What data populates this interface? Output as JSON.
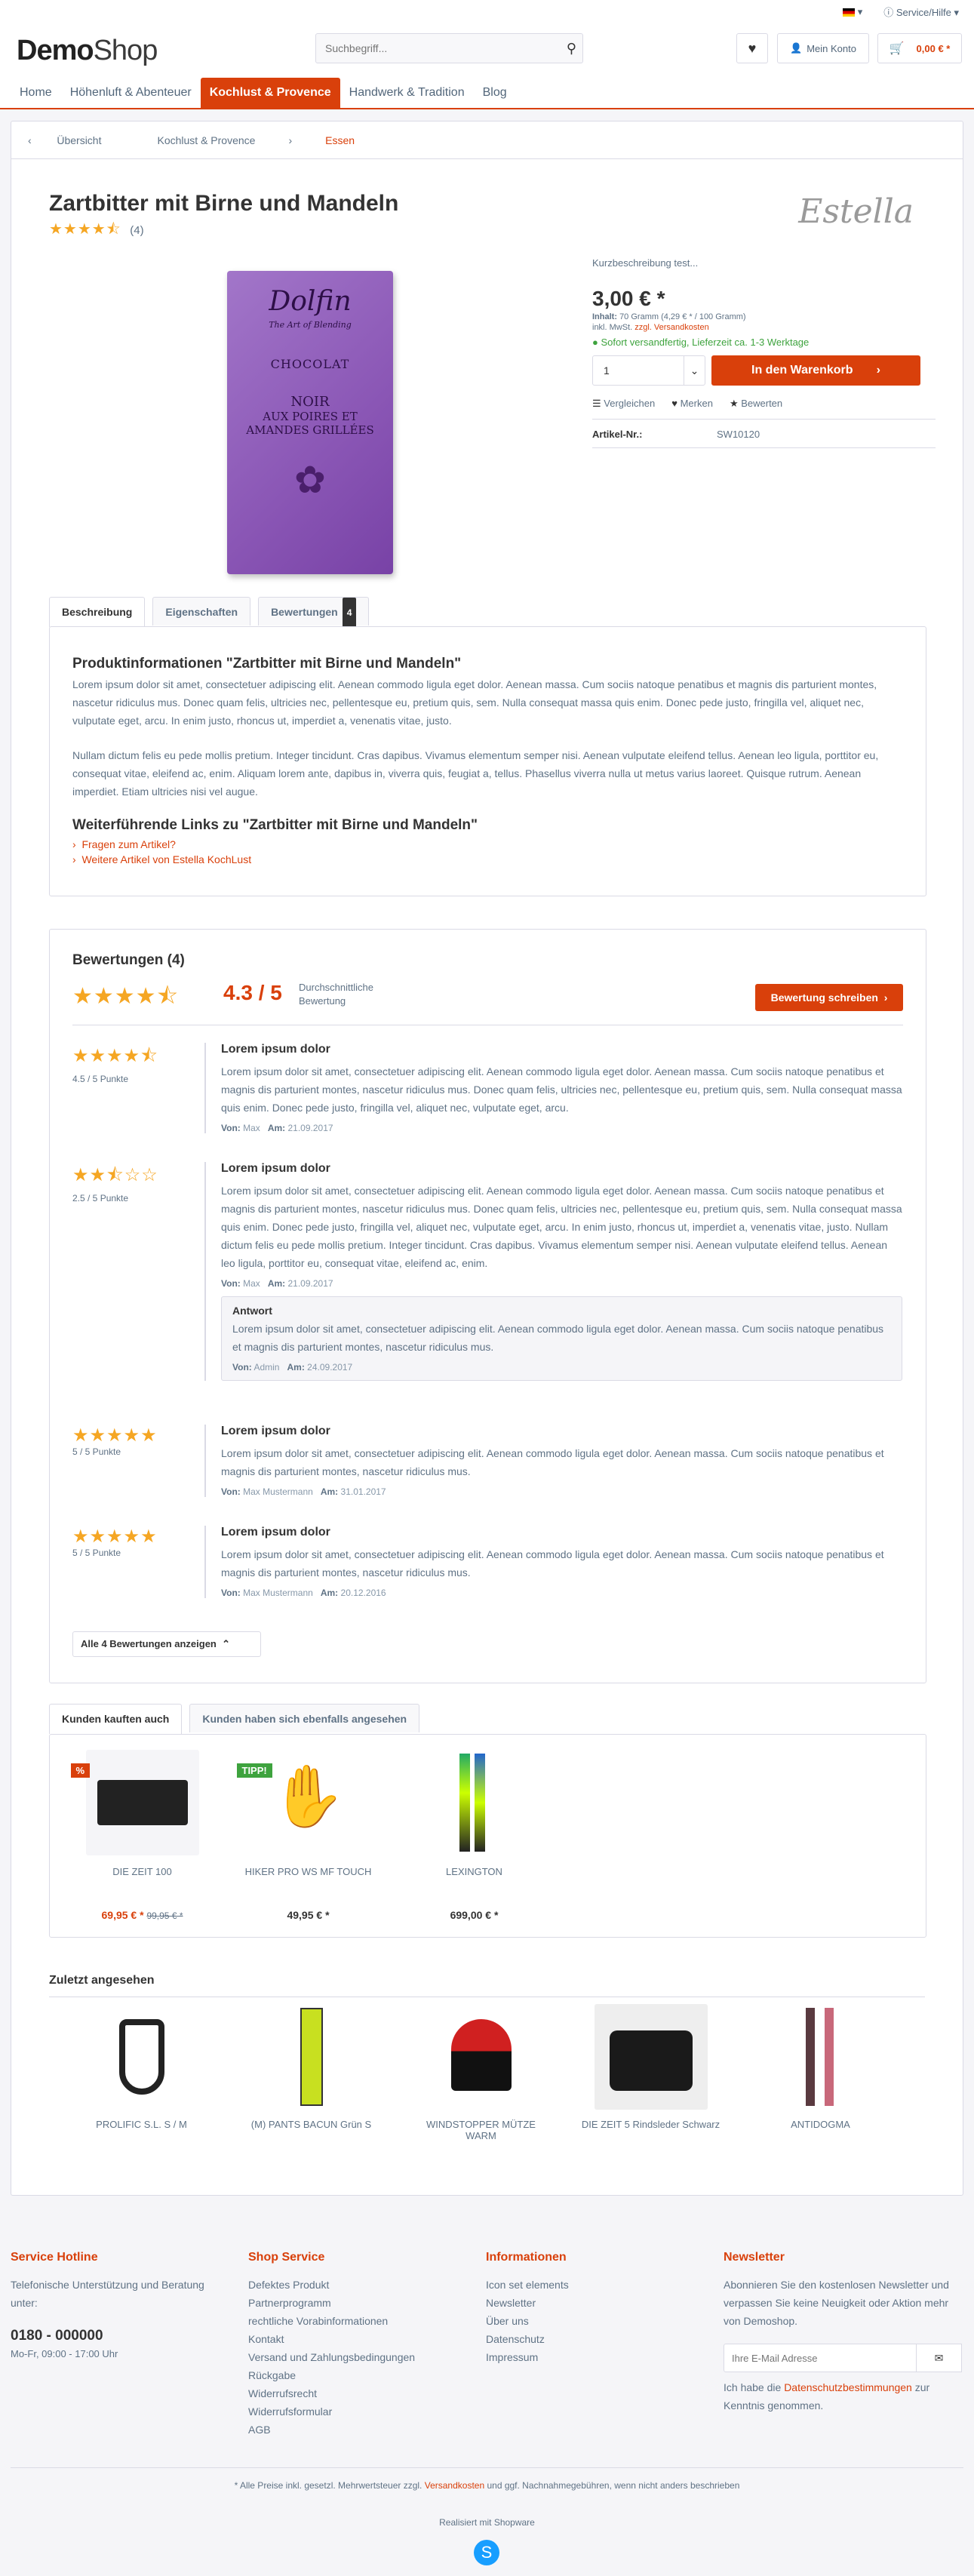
{
  "topbar": {
    "service": "Service/Hilfe"
  },
  "header": {
    "logo_a": "Demo",
    "logo_b": "Shop",
    "search_placeholder": "Suchbegriff...",
    "account": "Mein Konto",
    "cart_total": "0,00 € *"
  },
  "nav": {
    "items": [
      "Home",
      "Höhenluft & Abenteuer",
      "Kochlust & Provence",
      "Handwerk & Tradition",
      "Blog"
    ]
  },
  "breadcrumb": {
    "back": "Übersicht",
    "category": "Kochlust & Provence",
    "current": "Essen"
  },
  "product": {
    "title": "Zartbitter mit Birne und Mandeln",
    "rating_count": "(4)",
    "supplier": "Estella",
    "image_text": {
      "brand": "Dolfin",
      "sub": "The Art of Blending",
      "choc": "CHOCOLAT",
      "noir": "NOIR",
      "line1": "AUX POIRES ET",
      "line2": "AMANDES GRILLÉES"
    },
    "short_desc": "Kurzbeschreibung test...",
    "price": "3,00 € *",
    "content_label": "Inhalt:",
    "content": "70 Gramm (4,29 € * / 100 Gramm)",
    "tax": "inkl. MwSt.",
    "shipping_link": "zzgl. Versandkosten",
    "delivery": "Sofort versandfertig, Lieferzeit ca. 1-3 Werktage",
    "qty": "1",
    "cart_button": "In den Warenkorb",
    "compare": "Vergleichen",
    "remember": "Merken",
    "rate": "Bewerten",
    "sku_label": "Artikel-Nr.:",
    "sku": "SW10120"
  },
  "tabs": {
    "desc": "Beschreibung",
    "props": "Eigenschaften",
    "ratings": "Bewertungen",
    "ratings_count": "4"
  },
  "description": {
    "heading": "Produktinformationen \"Zartbitter mit Birne und Mandeln\"",
    "p1": "Lorem ipsum dolor sit amet, consectetuer adipiscing elit. Aenean commodo ligula eget dolor. Aenean massa. Cum sociis natoque penatibus et magnis dis parturient montes, nascetur ridiculus mus. Donec quam felis, ultricies nec, pellentesque eu, pretium quis, sem. Nulla consequat massa quis enim. Donec pede justo, fringilla vel, aliquet nec, vulputate eget, arcu. In enim justo, rhoncus ut, imperdiet a, venenatis vitae, justo.",
    "p2": "Nullam dictum felis eu pede mollis pretium. Integer tincidunt. Cras dapibus. Vivamus elementum semper nisi. Aenean vulputate eleifend tellus. Aenean leo ligula, porttitor eu, consequat vitae, eleifend ac, enim. Aliquam lorem ante, dapibus in, viverra quis, feugiat a, tellus. Phasellus viverra nulla ut metus varius laoreet. Quisque rutrum. Aenean imperdiet. Etiam ultricies nisi vel augue.",
    "links_heading": "Weiterführende Links zu \"Zartbitter mit Birne und Mandeln\"",
    "link1": "Fragen zum Artikel?",
    "link2": "Weitere Artikel von Estella KochLust"
  },
  "ratings": {
    "heading": "Bewertungen (4)",
    "avg": "4.3 / 5",
    "avg_label": "Durchschnittliche Bewertung",
    "write_button": "Bewertung schreiben",
    "show_all": "Alle 4 Bewertungen anzeigen",
    "reviews": [
      {
        "stars": "★★★★⯪",
        "points": "4.5 / 5 Punkte",
        "title": "Lorem ipsum dolor",
        "text": "Lorem ipsum dolor sit amet, consectetuer adipiscing elit. Aenean commodo ligula eget dolor. Aenean massa. Cum sociis natoque penatibus et magnis dis parturient montes, nascetur ridiculus mus. Donec quam felis, ultricies nec, pellentesque eu, pretium quis, sem. Nulla consequat massa quis enim. Donec pede justo, fringilla vel, aliquet nec, vulputate eget, arcu.",
        "von_label": "Von:",
        "author": "Max",
        "am_label": "Am:",
        "date": "21.09.2017"
      },
      {
        "stars": "★★⯪☆☆",
        "points": "2.5 / 5 Punkte",
        "title": "Lorem ipsum dolor",
        "text": "Lorem ipsum dolor sit amet, consectetuer adipiscing elit. Aenean commodo ligula eget dolor. Aenean massa. Cum sociis natoque penatibus et magnis dis parturient montes, nascetur ridiculus mus. Donec quam felis, ultricies nec, pellentesque eu, pretium quis, sem. Nulla consequat massa quis enim. Donec pede justo, fringilla vel, aliquet nec, vulputate eget, arcu. In enim justo, rhoncus ut, imperdiet a, venenatis vitae, justo. Nullam dictum felis eu pede mollis pretium. Integer tincidunt. Cras dapibus. Vivamus elementum semper nisi. Aenean vulputate eleifend tellus. Aenean leo ligula, porttitor eu, consequat vitae, eleifend ac, enim.",
        "von_label": "Von:",
        "author": "Max",
        "am_label": "Am:",
        "date": "21.09.2017",
        "answer": {
          "label": "Antwort",
          "text": "Lorem ipsum dolor sit amet, consectetuer adipiscing elit. Aenean commodo ligula eget dolor. Aenean massa. Cum sociis natoque penatibus et magnis dis parturient montes, nascetur ridiculus mus.",
          "author": "Admin",
          "date": "24.09.2017"
        }
      },
      {
        "stars": "★★★★★",
        "points": "5 / 5 Punkte",
        "title": "Lorem ipsum dolor",
        "text": "Lorem ipsum dolor sit amet, consectetuer adipiscing elit. Aenean commodo ligula eget dolor. Aenean massa. Cum sociis natoque penatibus et magnis dis parturient montes, nascetur ridiculus mus.",
        "von_label": "Von:",
        "author": "Max Mustermann",
        "am_label": "Am:",
        "date": "31.01.2017"
      },
      {
        "stars": "★★★★★",
        "points": "5 / 5 Punkte",
        "title": "Lorem ipsum dolor",
        "text": "Lorem ipsum dolor sit amet, consectetuer adipiscing elit. Aenean commodo ligula eget dolor. Aenean massa. Cum sociis natoque penatibus et magnis dis parturient montes, nascetur ridiculus mus.",
        "von_label": "Von:",
        "author": "Max Mustermann",
        "am_label": "Am:",
        "date": "20.12.2016"
      }
    ]
  },
  "crossselling": {
    "tab1": "Kunden kauften auch",
    "tab2": "Kunden haben sich ebenfalls angesehen",
    "products": [
      {
        "name": "DIE ZEIT 100",
        "price": "69,95 € *",
        "old_price": "99,95 € *",
        "badge": "%"
      },
      {
        "name": "HIKER PRO WS MF TOUCH",
        "price": "49,95 € *",
        "badge": "TIPP!"
      },
      {
        "name": "LEXINGTON",
        "price": "699,00 € *"
      }
    ]
  },
  "last_seen": {
    "heading": "Zuletzt angesehen",
    "products": [
      "PROLIFIC S.L. S / M",
      "(M) PANTS BACUN Grün S",
      "WINDSTOPPER MÜTZE WARM",
      "DIE ZEIT 5 Rindsleder Schwarz",
      "ANTIDOGMA"
    ]
  },
  "footer": {
    "hotline": {
      "title": "Service Hotline",
      "text": "Telefonische Unterstützung und Beratung unter:",
      "phone": "0180 - 000000",
      "hours": "Mo-Fr, 09:00 - 17:00 Uhr"
    },
    "shop_service": {
      "title": "Shop Service",
      "items": [
        "Defektes Produkt",
        "Partnerprogramm",
        "rechtliche Vorabinformationen",
        "Kontakt",
        "Versand und Zahlungsbedingungen",
        "Rückgabe",
        "Widerrufsrecht",
        "Widerrufsformular",
        "AGB"
      ]
    },
    "info": {
      "title": "Informationen",
      "items": [
        "Icon set elements",
        "Newsletter",
        "Über uns",
        "Datenschutz",
        "Impressum"
      ]
    },
    "newsletter": {
      "title": "Newsletter",
      "text": "Abonnieren Sie den kostenlosen Newsletter und verpassen Sie keine Neuigkeit oder Aktion mehr von Demoshop.",
      "placeholder": "Ihre E-Mail Adresse",
      "privacy_pre": "Ich habe die",
      "privacy_link": "Datenschutzbestimmungen",
      "privacy_post": "zur Kenntnis genommen."
    },
    "vat_pre": "* Alle Preise inkl. gesetzl. Mehrwertsteuer zzgl.",
    "vat_link": "Versandkosten",
    "vat_post": "und ggf. Nachnahmegebühren, wenn nicht anders beschrieben",
    "powered": "Realisiert mit Shopware"
  }
}
